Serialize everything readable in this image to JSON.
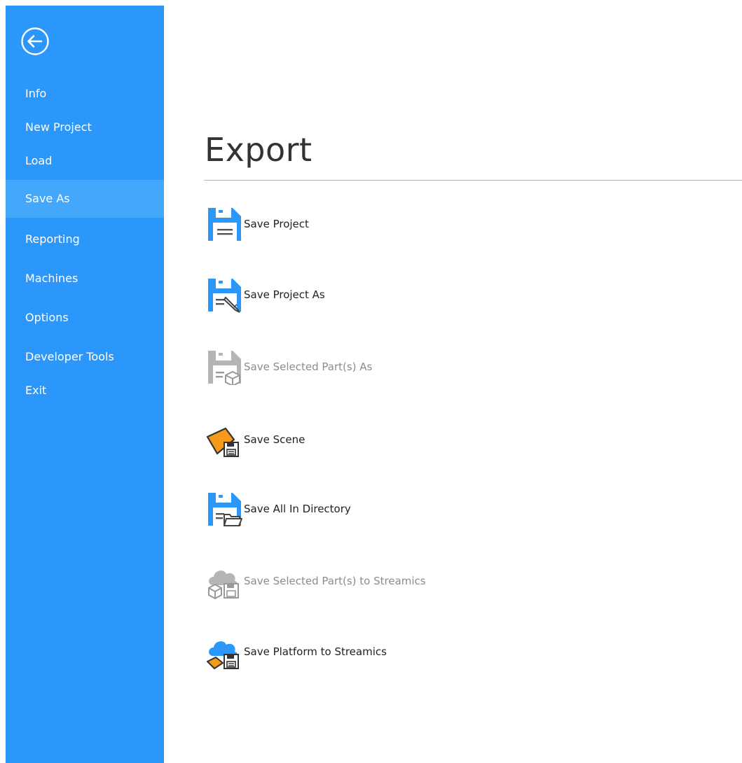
{
  "colors": {
    "sidebar_bg": "#2b97fb",
    "sidebar_active_bg": "#43a7fc",
    "icon_blue": "#2b97fb",
    "icon_orange": "#f59a1a",
    "icon_disabled": "#b5b5b5"
  },
  "sidebar": {
    "back_icon": "back-arrow-circle-icon",
    "items": [
      {
        "label": "Info"
      },
      {
        "label": "New Project"
      },
      {
        "label": "Load"
      },
      {
        "label": "Save As",
        "active": true
      },
      {
        "label": "Reporting"
      },
      {
        "label": "Machines"
      },
      {
        "label": "Options"
      },
      {
        "label": "Developer Tools"
      },
      {
        "label": "Exit"
      }
    ]
  },
  "main": {
    "title": "Export",
    "commands": [
      {
        "label": "Save Project",
        "icon": "floppy-disk-icon",
        "enabled": true
      },
      {
        "label": "Save Project As",
        "icon": "floppy-disk-pencil-icon",
        "enabled": true
      },
      {
        "label": "Save Selected Part(s) As",
        "icon": "floppy-disk-cube-icon",
        "enabled": false
      },
      {
        "label": "Save Scene",
        "icon": "scene-plate-floppy-icon",
        "enabled": true
      },
      {
        "label": "Save All In Directory",
        "icon": "floppy-disk-folder-icon",
        "enabled": true
      },
      {
        "label": "Save Selected Part(s) to Streamics",
        "icon": "cloud-cube-floppy-icon",
        "enabled": false
      },
      {
        "label": "Save Platform to Streamics",
        "icon": "cloud-plate-floppy-icon",
        "enabled": true
      }
    ]
  }
}
